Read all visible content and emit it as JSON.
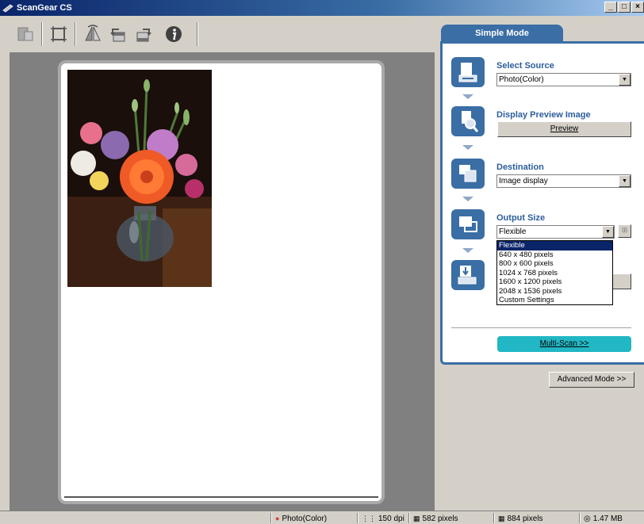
{
  "window": {
    "title": "ScanGear CS",
    "controls": [
      "_",
      "□",
      "×"
    ]
  },
  "toolbar": {
    "buttons": [
      {
        "name": "auto-crop-button",
        "icon": "auto-crop-icon"
      },
      {
        "name": "crop-button",
        "icon": "crop-frame-icon"
      },
      {
        "name": "mirror-button",
        "icon": "mirror-icon"
      },
      {
        "name": "rotate-left-button",
        "icon": "rotate-left-icon"
      },
      {
        "name": "rotate-right-button",
        "icon": "rotate-right-icon"
      },
      {
        "name": "info-button",
        "icon": "info-icon"
      }
    ]
  },
  "panel": {
    "tab_label": "Simple Mode",
    "select_source": {
      "label": "Select Source",
      "value": "Photo(Color)"
    },
    "display_preview": {
      "label": "Display Preview Image",
      "button": "Preview"
    },
    "destination": {
      "label": "Destination",
      "value": "Image display"
    },
    "output_size": {
      "label": "Output Size",
      "value": "Flexible",
      "options": [
        "Flexible",
        "640 x 480 pixels",
        "800 x 600 pixels",
        "1024 x 768 pixels",
        "1600 x 1200 pixels",
        "2048 x 1536 pixels",
        "Custom Settings"
      ]
    },
    "multi_scan": "Multi-Scan >>",
    "advanced_mode": "Advanced Mode >>"
  },
  "status": {
    "source": "Photo(Color)",
    "resolution": "150 dpi",
    "width": "582 pixels",
    "height": "884 pixels",
    "size": "1.47 MB"
  },
  "colors": {
    "accent": "#3a6ea5",
    "multi_scan": "#21b7c4",
    "title_bar": "#0a246a"
  }
}
